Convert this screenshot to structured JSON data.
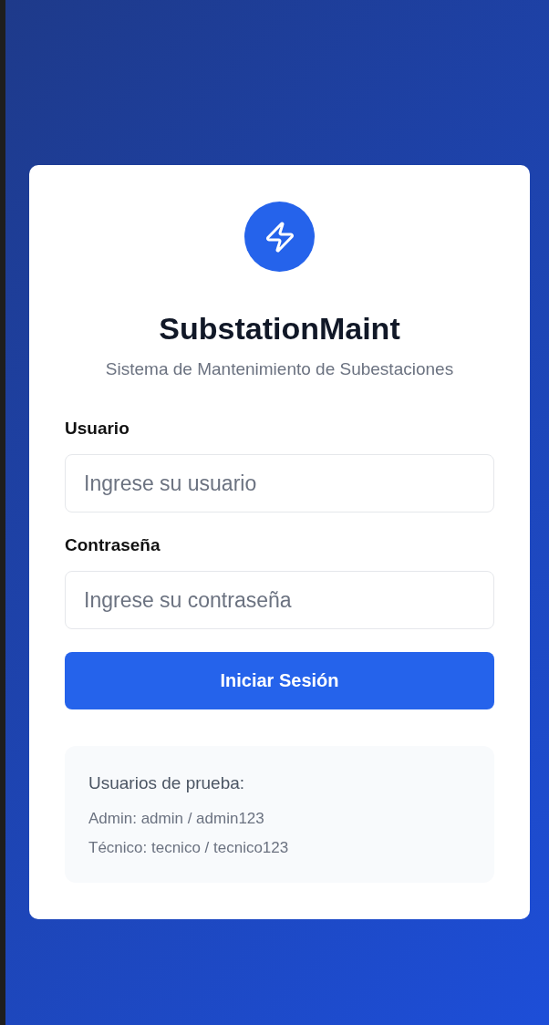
{
  "app": {
    "title": "SubstationMaint",
    "subtitle": "Sistema de Mantenimiento de Subestaciones"
  },
  "form": {
    "fields": [
      {
        "label": "Usuario",
        "placeholder": "Ingrese su usuario"
      },
      {
        "label": "Contraseña",
        "placeholder": "Ingrese su contraseña"
      }
    ],
    "submit": "Iniciar Sesión"
  },
  "test_users": {
    "title": "Usuarios de prueba:",
    "lines": [
      "Admin: admin / admin123",
      "Técnico: tecnico / tecnico123"
    ]
  }
}
